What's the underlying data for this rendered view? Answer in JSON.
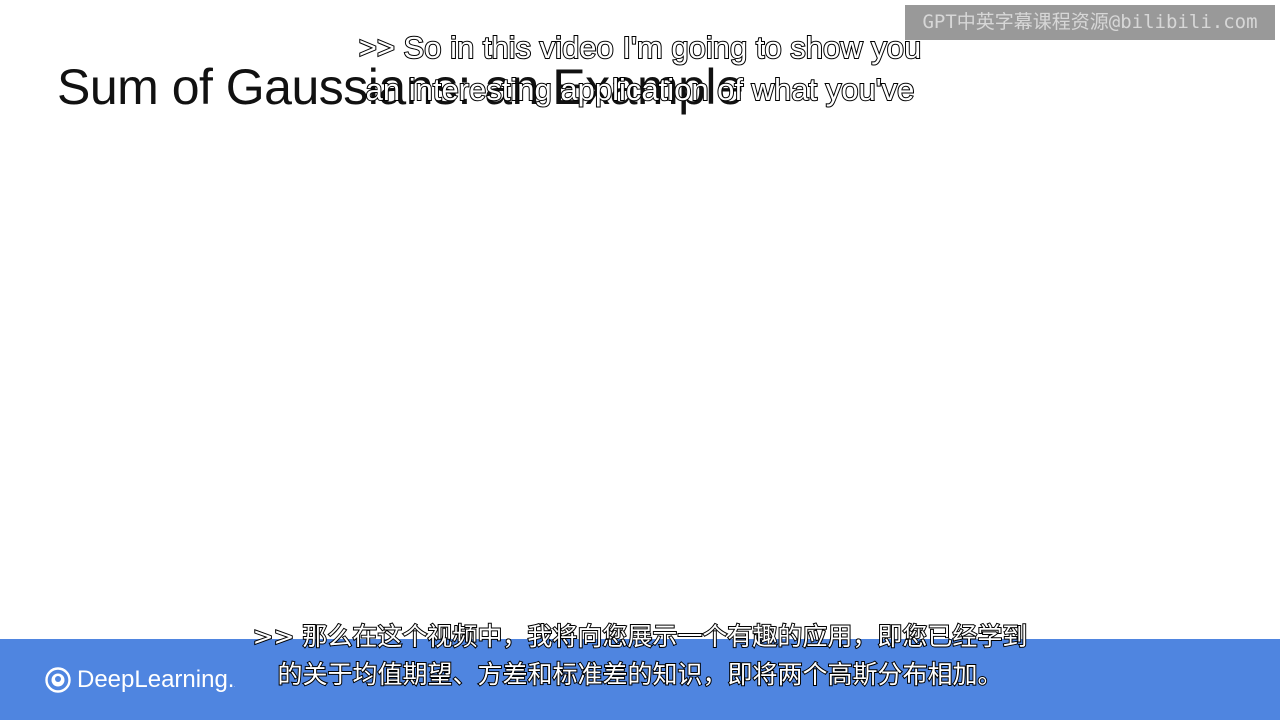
{
  "slide": {
    "title": "Sum of Gaussians: an Example"
  },
  "watermark": {
    "text": "GPT中英字幕课程资源@bilibili.com"
  },
  "captions": {
    "english": [
      ">> So in this video I'm going to show you",
      "an interesting application of what you've"
    ],
    "chinese": [
      ">> 那么在这个视频中，我将向您展示一个有趣的应用，即您已经学到",
      "的关于均值期望、方差和标准差的知识，即将两个高斯分布相加。"
    ]
  },
  "footer": {
    "brand": "DeepLearning.AI",
    "logo_icon": "deeplearning-logo-icon",
    "color": "#4f85e0"
  }
}
